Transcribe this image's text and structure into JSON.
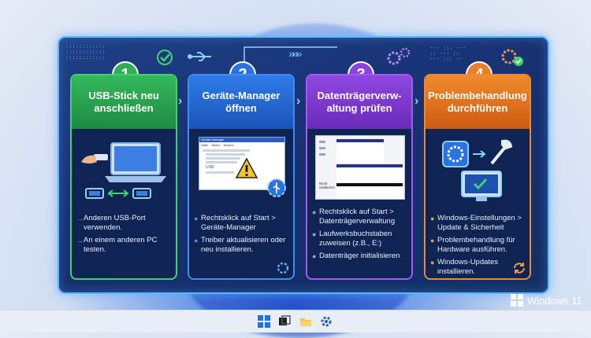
{
  "steps": [
    {
      "num": "1",
      "title": "USB-Stick neu anschließen",
      "tips": [
        "Anderen USB-Port verwenden.",
        "An einem anderen PC testen."
      ]
    },
    {
      "num": "2",
      "title": "Geräte-Manager öffnen",
      "tips": [
        "Rechtsklick auf Start > Geräte-Manager",
        "Treiber aktualisieren oder neu installieren."
      ]
    },
    {
      "num": "3",
      "title": "Datenträgerverw-altung prüfen",
      "tips": [
        "Rechtsklick auf Start > Datenträgerverwaltung",
        "Laufwerksbuchstaben zuweisen (z.B., E:)",
        "Datenträger initialisieren"
      ]
    },
    {
      "num": "4",
      "title": "Problembehandlung durchführen",
      "tips": [
        "Windows-Einstellungen > Update & Sicherheit",
        "Problembehandlung für Hardware ausführen.",
        "Windows-Updates installieren."
      ]
    }
  ],
  "mockups": {
    "device_manager_title": "Geräte-Manager",
    "device_manager_menu": [
      "Datei",
      "Aktion",
      "Ansicht"
    ],
    "usb_label": "USB",
    "disk_label": "Nicht initialisiert"
  },
  "branding": "Windows 11",
  "colors": {
    "step1": "#34b95c",
    "step2": "#2f7ae8",
    "step3": "#8f47e0",
    "step4": "#f08a2c"
  },
  "taskbar_icons": [
    "windows-start-icon",
    "task-view-icon",
    "file-explorer-icon",
    "settings-icon"
  ]
}
